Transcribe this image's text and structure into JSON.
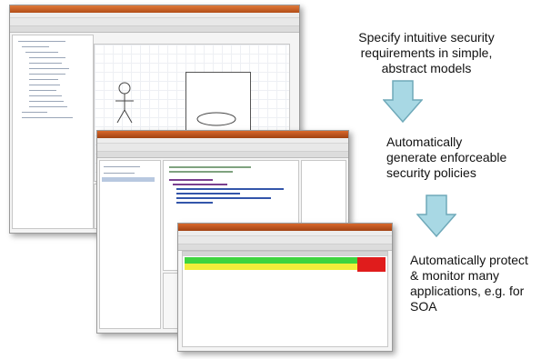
{
  "callouts": [
    {
      "line1": "Specify intuitive security",
      "line2": "requirements in simple,",
      "line3": "abstract models"
    },
    {
      "line1": "Automatically",
      "line2": "generate enforceable",
      "line3": "security policies"
    },
    {
      "line1": "Automatically protect",
      "line2": "& monitor many",
      "line3": "applications, e.g. for",
      "line4": "SOA"
    }
  ],
  "colors": {
    "arrow_fill": "#a8d8e4",
    "arrow_stroke": "#6fa9b9",
    "title_orange": "#d0632a",
    "row_green": "#3fd43f",
    "row_yellow": "#f2ee3a",
    "row_red": "#e01c1c"
  },
  "icons": [
    "actor-icon",
    "use-case-ellipse-icon",
    "down-arrow-icon"
  ]
}
